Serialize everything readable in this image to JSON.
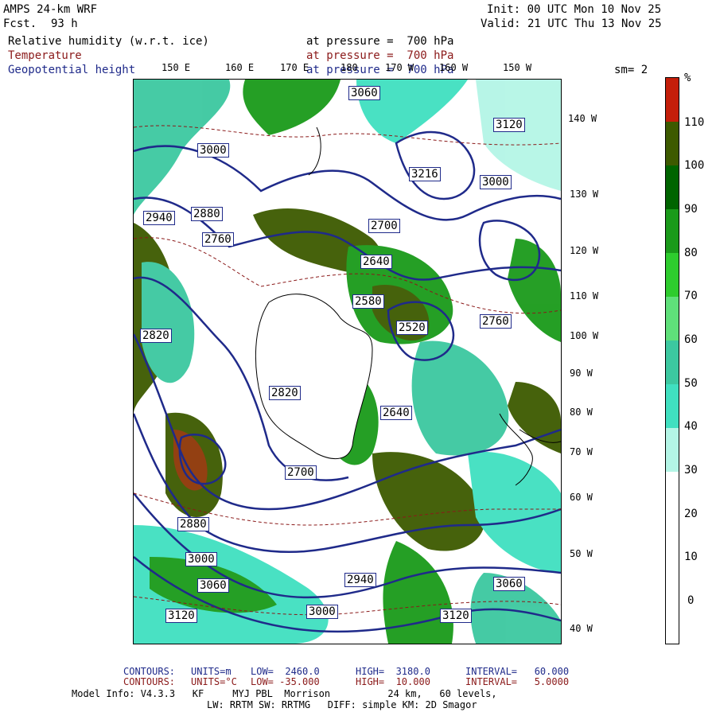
{
  "header": {
    "model": "AMPS 24-km WRF",
    "fcst_label": "Fcst.",
    "fcst_value": "93 h",
    "init": "Init: 00 UTC Mon 10 Nov 25",
    "valid": "Valid: 21 UTC Thu 13 Nov 25",
    "fields": [
      {
        "name": "Relative humidity (w.r.t. ice)",
        "level": "at pressure =  700 hPa",
        "color": "#000000"
      },
      {
        "name": "Temperature",
        "level": "at pressure =  700 hPa",
        "color": "#8b1a1a"
      },
      {
        "name": "Geopotential height",
        "level": "at pressure =  700 hPa",
        "color": "#1f2a8a"
      }
    ],
    "sm": "sm= 2"
  },
  "top_lon_labels": [
    "150 E",
    "160 E",
    "170 E",
    "180",
    "170 W",
    "160 W",
    "150 W"
  ],
  "right_lon_labels": [
    "140 W",
    "130 W",
    "120 W",
    "110 W",
    "100 W",
    "90 W",
    "80 W",
    "70 W",
    "60 W",
    "50 W",
    "40 W"
  ],
  "height_labels": [
    "3060",
    "3120",
    "3000",
    "2940",
    "2880",
    "3216",
    "2760",
    "2700",
    "2640",
    "2580",
    "2820",
    "2520",
    "3000",
    "2760",
    "2640",
    "2820",
    "2880",
    "3060",
    "3120",
    "2700",
    "3000",
    "2940",
    "3060",
    "3120",
    "3000"
  ],
  "colorbar": {
    "unit": "%",
    "labels": [
      "110",
      "100",
      "90",
      "80",
      "70",
      "60",
      "50",
      "40",
      "30",
      "20",
      "10",
      "0"
    ],
    "colors": [
      "#c41e0a",
      "#3d5a00",
      "#006400",
      "#1a9a1a",
      "#2ecc2e",
      "#5fe07a",
      "#3cc8a0",
      "#40e0c0",
      "#b4f5e6",
      "#ffffff",
      "#ffffff",
      "#ffffff",
      "#ffffff"
    ]
  },
  "footer": {
    "line1_prefix": "CONTOURS:",
    "line1_units": "UNITS=m",
    "line1_low": "LOW=  2460.0",
    "line1_high": "HIGH=  3180.0",
    "line1_int": "INTERVAL=   60.000",
    "line2_prefix": "CONTOURS:",
    "line2_units": "UNITS=°C",
    "line2_low": "LOW= -35.000",
    "line2_high": "HIGH=  10.000",
    "line2_int": "INTERVAL=   5.0000",
    "line3": "Model Info: V4.3.3   KF     MYJ PBL  Morrison          24 km,   60 levels,",
    "line4": "LW: RRTM SW: RRTMG   DIFF: simple KM: 2D Smagor"
  }
}
